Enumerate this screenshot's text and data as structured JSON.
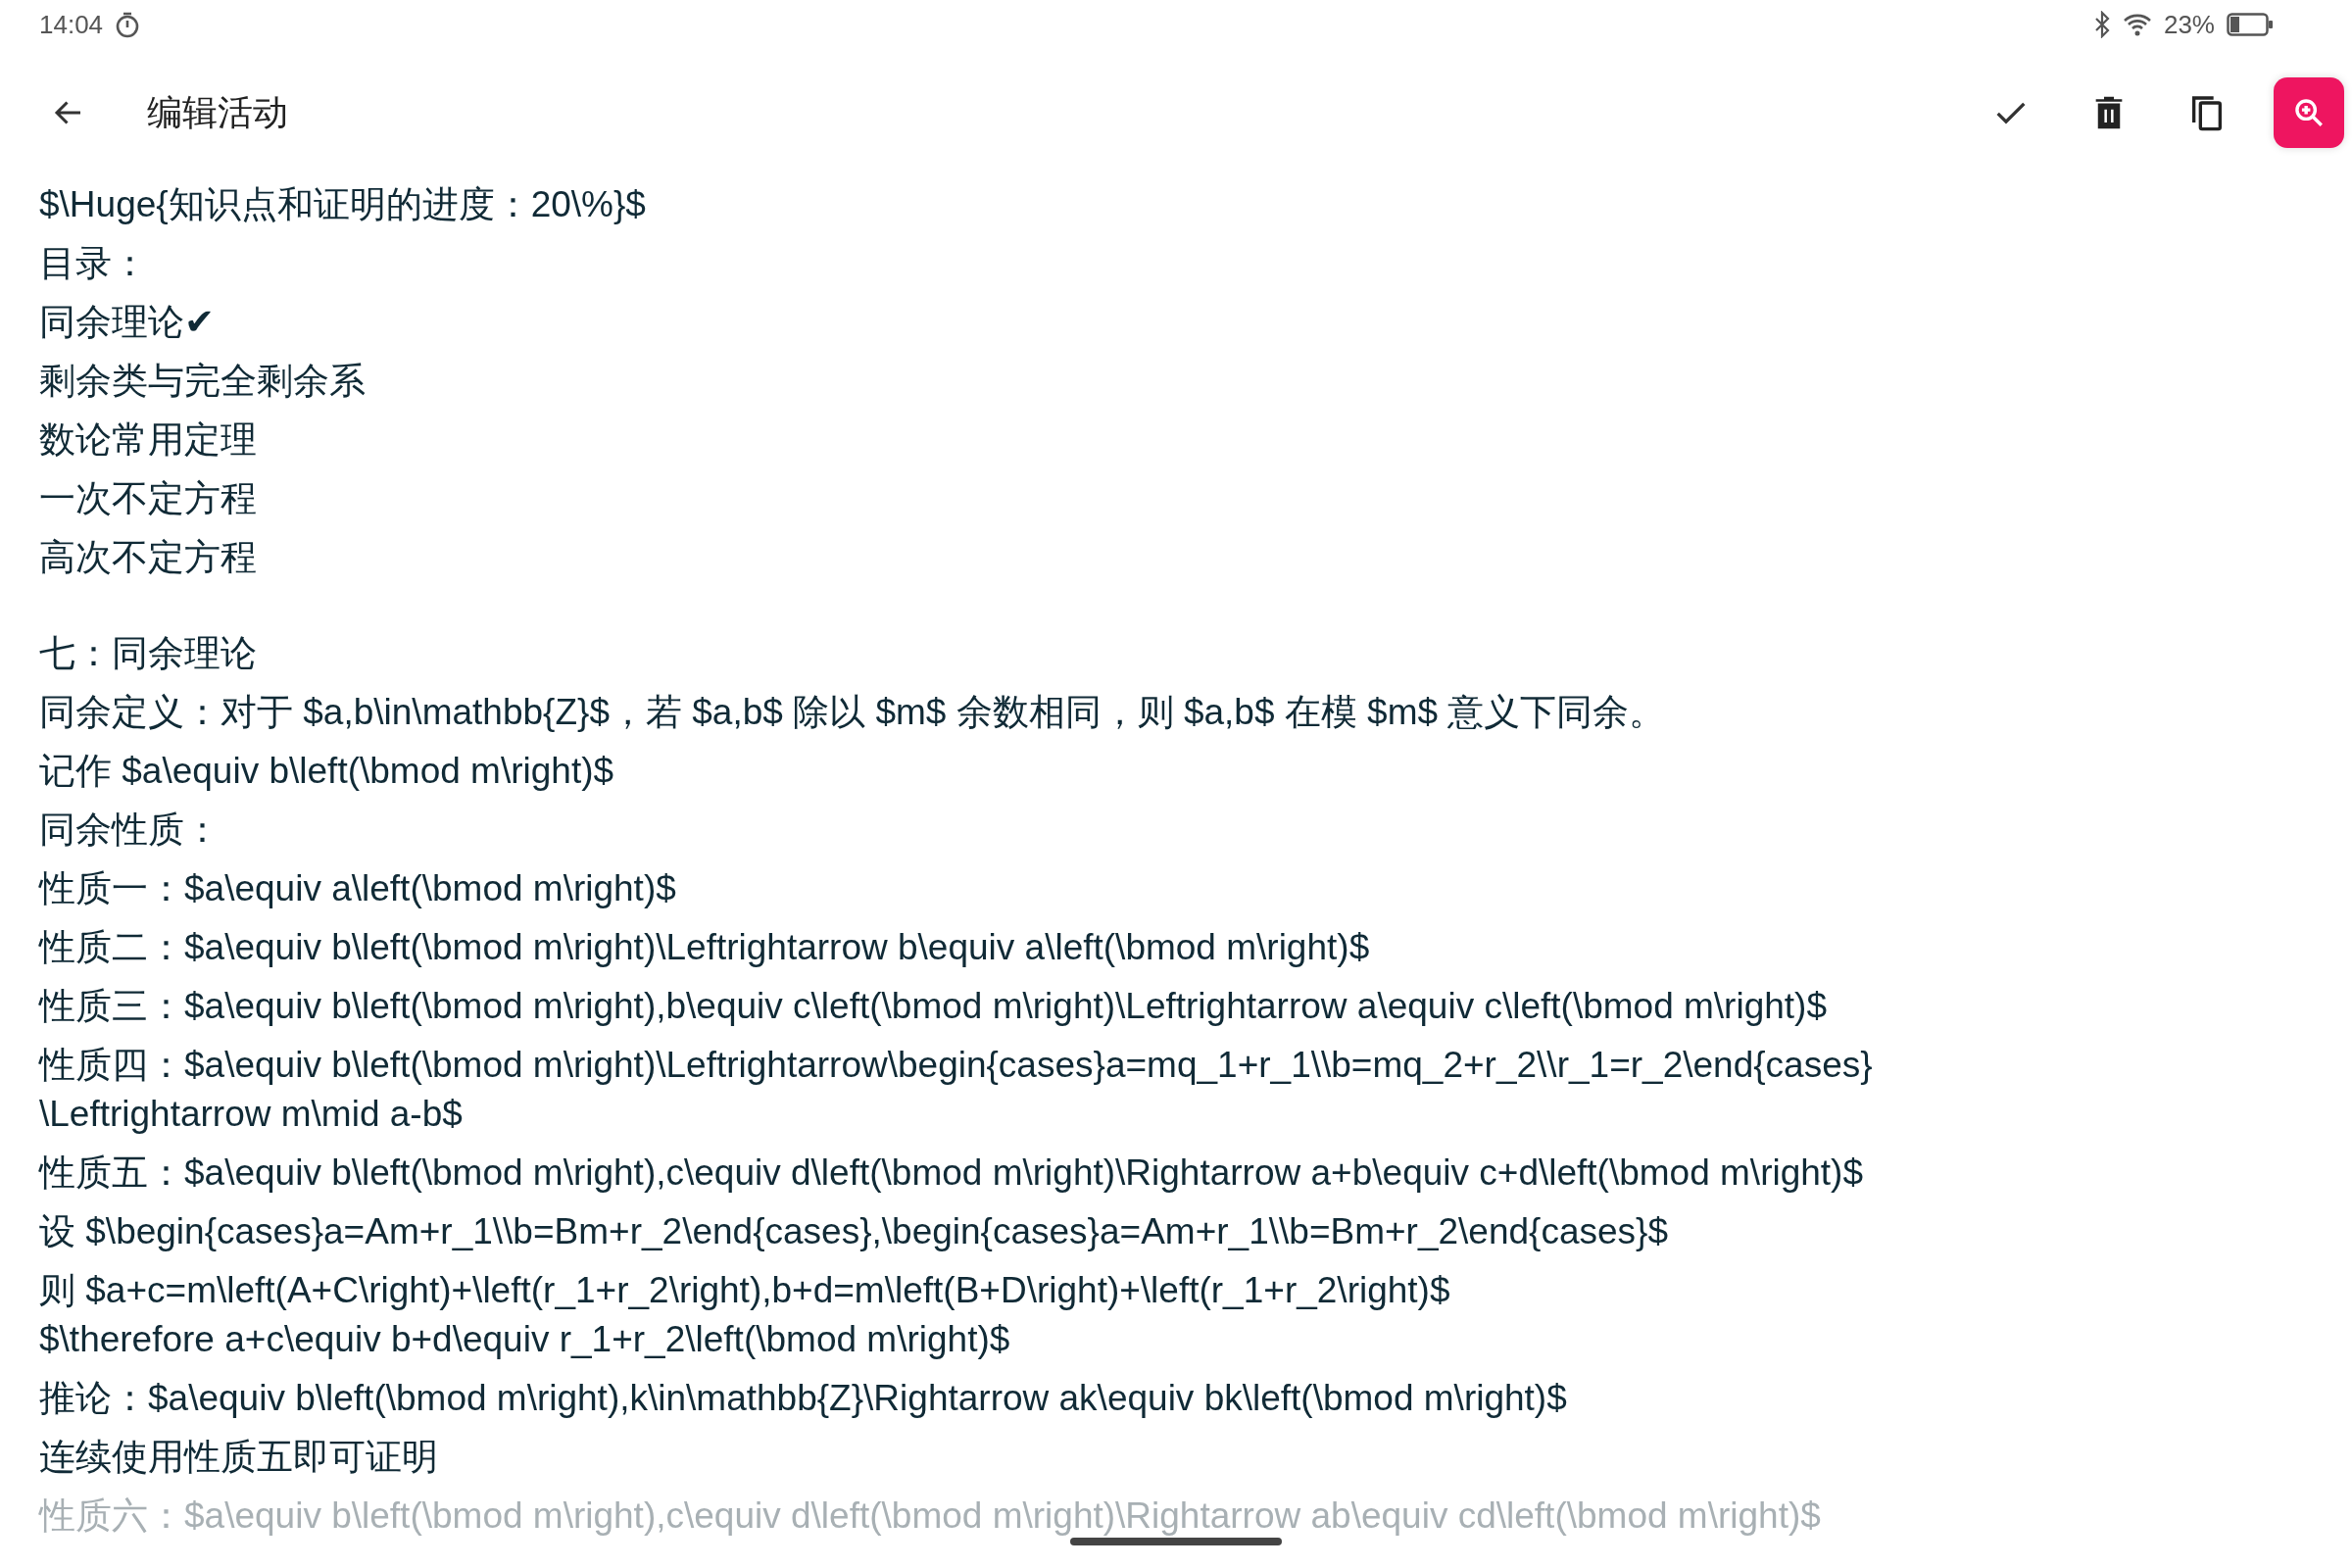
{
  "status_bar": {
    "time": "14:04",
    "battery": "23%"
  },
  "toolbar": {
    "title": "编辑活动"
  },
  "editor": {
    "sections": [
      {
        "paragraphs": [
          [
            "$\\Huge{知识点和证明的进度：20\\%}$"
          ],
          [
            "目录："
          ],
          [
            "同余理论✔"
          ],
          [
            "剩余类与完全剩余系"
          ],
          [
            "数论常用定理"
          ],
          [
            "一次不定方程"
          ],
          [
            "高次不定方程"
          ]
        ]
      },
      {
        "paragraphs": [
          [
            "七：同余理论"
          ],
          [
            "同余定义：对于 $a,b\\in\\mathbb{Z}$，若 $a,b$ 除以 $m$ 余数相同，则 $a,b$ 在模 $m$ 意义下同余。"
          ],
          [
            "记作 $a\\equiv b\\left(\\bmod m\\right)$"
          ],
          [
            "同余性质："
          ],
          [
            "性质一：$a\\equiv a\\left(\\bmod m\\right)$"
          ],
          [
            "性质二：$a\\equiv b\\left(\\bmod m\\right)\\Leftrightarrow b\\equiv a\\left(\\bmod m\\right)$"
          ],
          [
            "性质三：$a\\equiv b\\left(\\bmod m\\right),b\\equiv c\\left(\\bmod m\\right)\\Leftrightarrow a\\equiv c\\left(\\bmod m\\right)$"
          ],
          [
            "性质四：$a\\equiv b\\left(\\bmod m\\right)\\Leftrightarrow\\begin{cases}a=mq_1+r_1\\\\b=mq_2+r_2\\\\r_1=r_2\\end{cases}",
            "\\Leftrightarrow m\\mid a-b$"
          ],
          [
            "性质五：$a\\equiv b\\left(\\bmod m\\right),c\\equiv d\\left(\\bmod m\\right)\\Rightarrow a+b\\equiv c+d\\left(\\bmod m\\right)$"
          ],
          [
            "设 $\\begin{cases}a=Am+r_1\\\\b=Bm+r_2\\end{cases},\\begin{cases}a=Am+r_1\\\\b=Bm+r_2\\end{cases}$"
          ],
          [
            "则 $a+c=m\\left(A+C\\right)+\\left(r_1+r_2\\right),b+d=m\\left(B+D\\right)+\\left(r_1+r_2\\right)$",
            "$\\therefore a+c\\equiv b+d\\equiv r_1+r_2\\left(\\bmod m\\right)$"
          ],
          [
            "推论：$a\\equiv b\\left(\\bmod m\\right),k\\in\\mathbb{Z}\\Rightarrow ak\\equiv bk\\left(\\bmod m\\right)$"
          ],
          [
            "连续使用性质五即可证明"
          ],
          [
            "性质六：$a\\equiv b\\left(\\bmod m\\right),c\\equiv d\\left(\\bmod m\\right)\\Rightarrow ab\\equiv cd\\left(\\bmod m\\right)$"
          ]
        ]
      }
    ]
  }
}
